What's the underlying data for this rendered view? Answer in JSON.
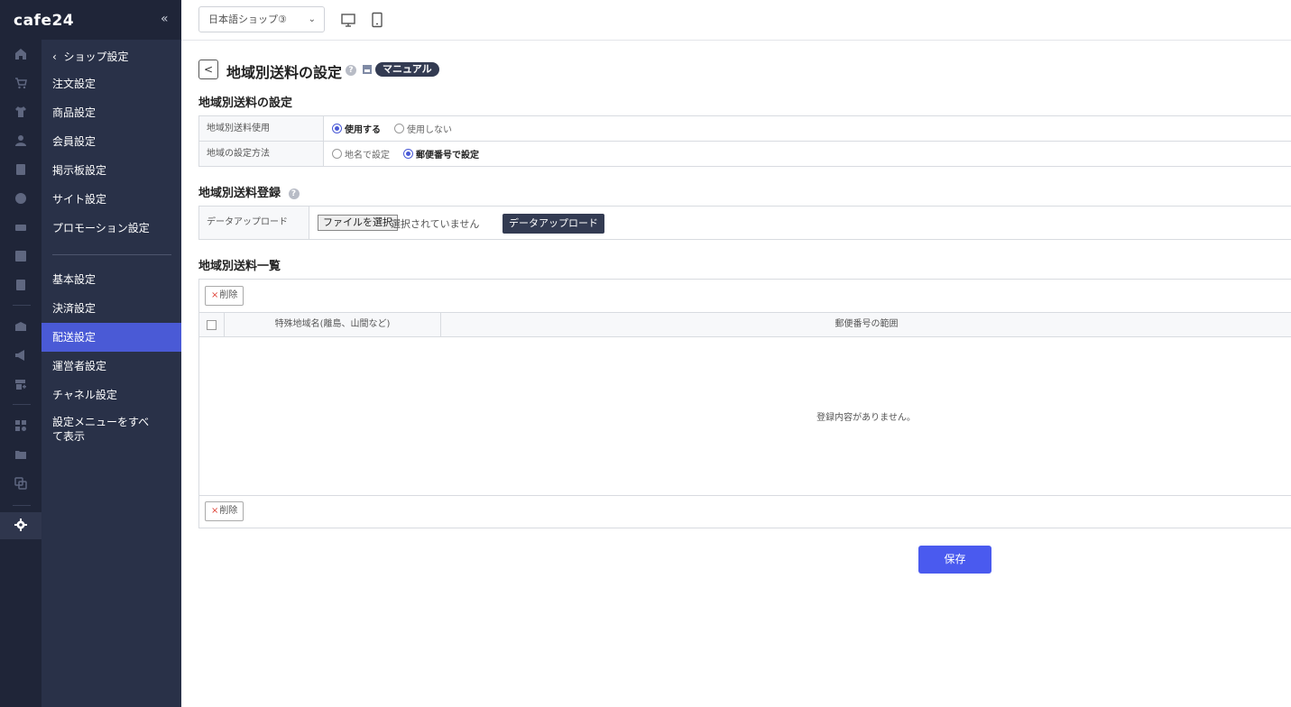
{
  "brand": {
    "logo": "cafe24",
    "collapse_icon": "«"
  },
  "rail": {
    "icons": [
      "home-icon",
      "cart-icon",
      "shirt-icon",
      "user-icon",
      "board-icon",
      "palette-icon",
      "coupon-icon",
      "stats-icon",
      "excel-icon",
      "box-icon",
      "megaphone-icon",
      "store-add-icon",
      "apps-icon",
      "folder-add-icon",
      "copy-icon",
      "gear-icon"
    ]
  },
  "submenu": {
    "back_label": "ショップ設定",
    "items_top": [
      "注文設定",
      "商品設定",
      "会員設定",
      "掲示板設定",
      "サイト設定",
      "プロモーション設定"
    ],
    "items_bottom": [
      "基本設定",
      "決済設定",
      "配送設定",
      "運営者設定",
      "チャネル設定",
      "設定メニューをすべて表示"
    ],
    "active": "配送設定"
  },
  "topbar": {
    "shop_select": "日本語ショップ③"
  },
  "page": {
    "title": "地域別送料の設定",
    "manual_label": "マニュアル",
    "help_mark": "?"
  },
  "settings": {
    "section_title": "地域別送料の設定",
    "rows": [
      {
        "label": "地域別送料使用",
        "options": [
          "使用する",
          "使用しない"
        ],
        "selected": 0
      },
      {
        "label": "地域の設定方法",
        "options": [
          "地名で設定",
          "郵便番号で設定"
        ],
        "selected": 1
      }
    ]
  },
  "register": {
    "section_title": "地域別送料登録",
    "label": "データアップロード",
    "file_button": "ファイルを選択",
    "file_status": "選択されていません",
    "upload_button": "データアップロード"
  },
  "list": {
    "section_title": "地域別送料一覧",
    "delete_label": "削除",
    "columns": [
      "特殊地域名(離島、山間など)",
      "郵便番号の範囲"
    ],
    "empty_message": "登録内容がありません。"
  },
  "save_label": "保存"
}
